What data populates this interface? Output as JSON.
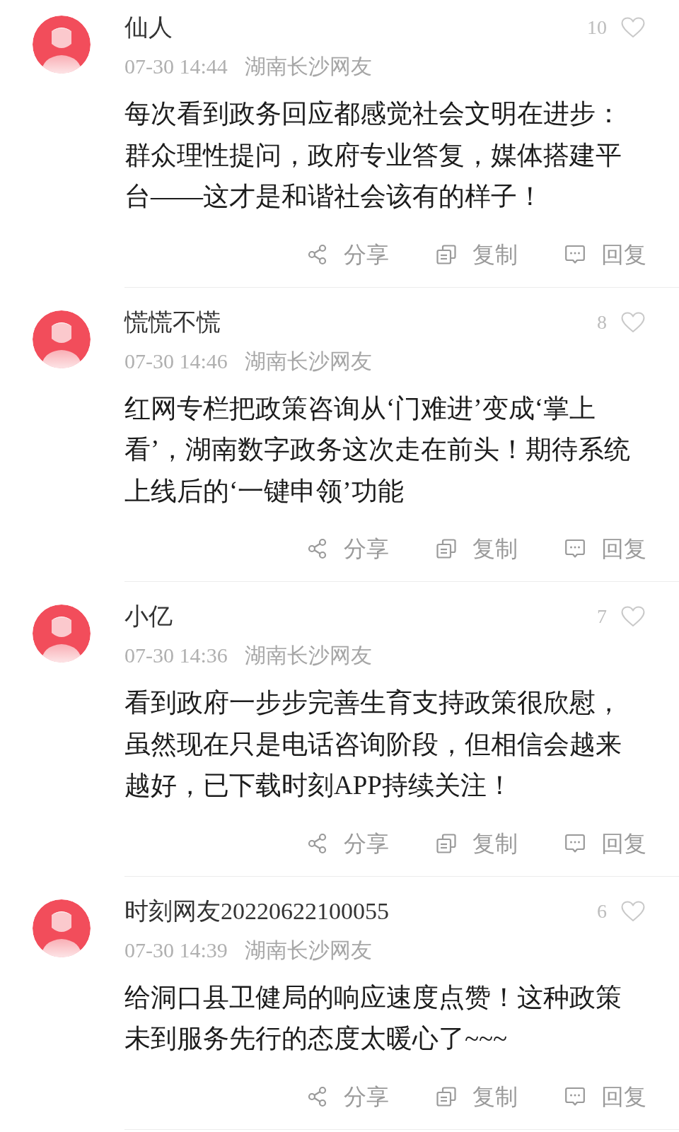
{
  "comments": [
    {
      "name": "仙人",
      "likes": "10",
      "liked": false,
      "time": "07-30 14:44",
      "location": "湖南长沙网友",
      "body": "每次看到政务回应都感觉社会文明在进步：群众理性提问，政府专业答复，媒体搭建平台——这才是和谐社会该有的样子！",
      "actions": [
        {
          "kind": "share",
          "label": "分享"
        },
        {
          "kind": "copy",
          "label": "复制"
        },
        {
          "kind": "reply",
          "label": "回复"
        }
      ]
    },
    {
      "name": "慌慌不慌",
      "likes": "8",
      "liked": false,
      "time": "07-30 14:46",
      "location": "湖南长沙网友",
      "body": "红网专栏把政策咨询从‘门难进’变成‘掌上看’，湖南数字政务这次走在前头！期待系统上线后的‘一键申领’功能",
      "actions": [
        {
          "kind": "share",
          "label": "分享"
        },
        {
          "kind": "copy",
          "label": "复制"
        },
        {
          "kind": "reply",
          "label": "回复"
        }
      ]
    },
    {
      "name": "小亿",
      "likes": "7",
      "liked": false,
      "time": "07-30 14:36",
      "location": "湖南长沙网友",
      "body": "看到政府一步步完善生育支持政策很欣慰，虽然现在只是电话咨询阶段，但相信会越来越好，已下载时刻APP持续关注！",
      "actions": [
        {
          "kind": "share",
          "label": "分享"
        },
        {
          "kind": "copy",
          "label": "复制"
        },
        {
          "kind": "reply",
          "label": "回复"
        }
      ]
    },
    {
      "name": "时刻网友20220622100055",
      "likes": "6",
      "liked": false,
      "time": "07-30 14:39",
      "location": "湖南长沙网友",
      "body": "给洞口县卫健局的响应速度点赞！这种政策未到服务先行的态度太暖心了~~~",
      "actions": [
        {
          "kind": "share",
          "label": "分享"
        },
        {
          "kind": "copy",
          "label": "复制"
        },
        {
          "kind": "reply",
          "label": "回复"
        }
      ]
    }
  ]
}
